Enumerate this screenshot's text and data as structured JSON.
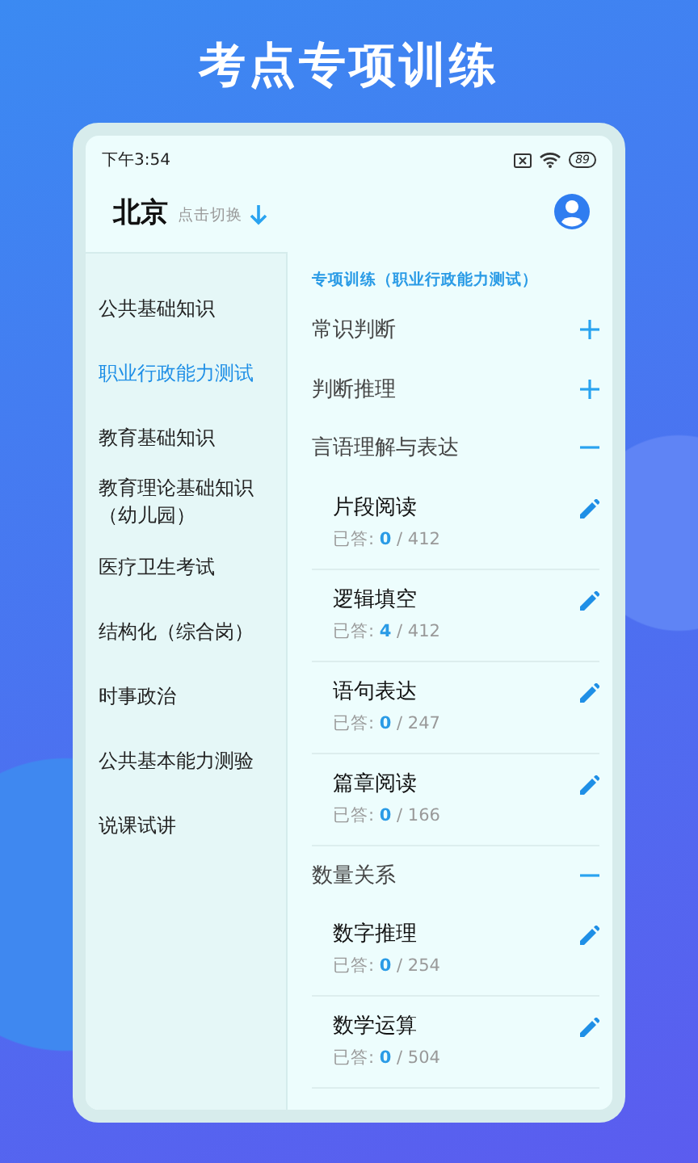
{
  "heading": "考点专项训练",
  "status_bar": {
    "time": "下午3:54",
    "battery": "89"
  },
  "header": {
    "city": "北京",
    "switch_hint": "点击切换"
  },
  "sidebar": {
    "items": [
      {
        "label": "公共基础知识",
        "selected": false
      },
      {
        "label": "职业行政能力测试",
        "selected": true
      },
      {
        "label": "教育基础知识",
        "selected": false
      },
      {
        "label": "教育理论基础知识（幼儿园）",
        "selected": false
      },
      {
        "label": "医疗卫生考试",
        "selected": false
      },
      {
        "label": "结构化（综合岗）",
        "selected": false
      },
      {
        "label": "时事政治",
        "selected": false
      },
      {
        "label": "公共基本能力测验",
        "selected": false
      },
      {
        "label": "说课试讲",
        "selected": false
      }
    ]
  },
  "content": {
    "title": "专项训练（职业行政能力测试）",
    "sections": [
      {
        "name": "常识判断",
        "expanded": false
      },
      {
        "name": "判断推理",
        "expanded": false
      },
      {
        "name": "言语理解与表达",
        "expanded": true,
        "children": [
          {
            "name": "片段阅读",
            "answered_label": "已答:",
            "answered": "0",
            "total": "/ 412"
          },
          {
            "name": "逻辑填空",
            "answered_label": "已答:",
            "answered": "4",
            "total": "/ 412"
          },
          {
            "name": "语句表达",
            "answered_label": "已答:",
            "answered": "0",
            "total": "/ 247"
          },
          {
            "name": "篇章阅读",
            "answered_label": "已答:",
            "answered": "0",
            "total": "/ 166"
          }
        ]
      },
      {
        "name": "数量关系",
        "expanded": true,
        "children": [
          {
            "name": "数字推理",
            "answered_label": "已答:",
            "answered": "0",
            "total": "/ 254"
          },
          {
            "name": "数学运算",
            "answered_label": "已答:",
            "answered": "0",
            "total": "/ 504"
          }
        ]
      }
    ]
  }
}
